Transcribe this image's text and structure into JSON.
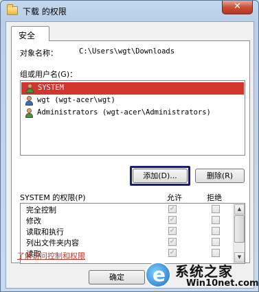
{
  "window": {
    "title": "下载 的权限",
    "close_label": "✕",
    "tab_label": "安全"
  },
  "object": {
    "label": "对象名称：",
    "value": "C:\\Users\\wgt\\Downloads"
  },
  "groups": {
    "label": "组或用户名(G)：",
    "users": [
      {
        "name": "SYSTEM",
        "selected": true,
        "icon": "user-group-icon"
      },
      {
        "name": "wgt (wgt-acer\\wgt)",
        "selected": false,
        "icon": "user-icon"
      },
      {
        "name": "Administrators (wgt-acer\\Administrators)",
        "selected": false,
        "icon": "user-group-icon"
      }
    ],
    "add_button": "添加(D)...",
    "remove_button": "删除(R)"
  },
  "permissions": {
    "title": "SYSTEM 的权限(P)",
    "allow_header": "允许",
    "deny_header": "拒绝",
    "rows": [
      {
        "name": "完全控制",
        "allow": true,
        "deny": false
      },
      {
        "name": "修改",
        "allow": true,
        "deny": false
      },
      {
        "name": "读取和执行",
        "allow": true,
        "deny": false
      },
      {
        "name": "列出文件夹内容",
        "allow": true,
        "deny": false
      },
      {
        "name": "读取",
        "allow": true,
        "deny": false
      }
    ]
  },
  "link_text": "了解访问控制和权限",
  "ok_button": "确定",
  "watermark": {
    "title": "系统之家",
    "url": "Win10net.com"
  }
}
